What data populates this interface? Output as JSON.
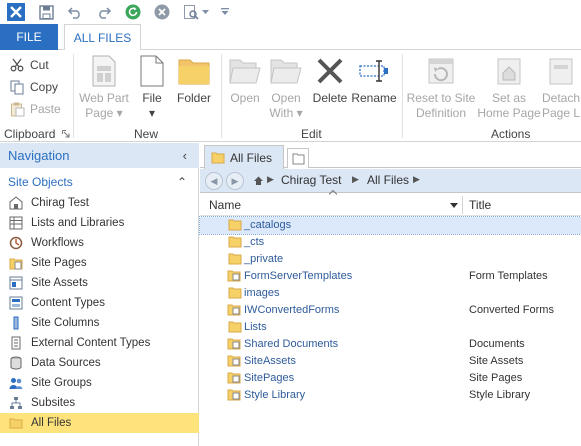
{
  "ribbon_tabs": {
    "file": "FILE",
    "all_files": "ALL FILES"
  },
  "clipboard": {
    "cut": "Cut",
    "copy": "Copy",
    "paste": "Paste",
    "group": "Clipboard"
  },
  "new_group": {
    "web_part_page_1": "Web Part",
    "web_part_page_2": "Page",
    "file": "File",
    "folder": "Folder",
    "group": "New"
  },
  "edit_group": {
    "open": "Open",
    "open_with_1": "Open",
    "open_with_2": "With",
    "delete": "Delete",
    "rename": "Rename",
    "group": "Edit"
  },
  "actions_group": {
    "reset_1": "Reset to Site",
    "reset_2": "Definition",
    "home_1": "Set as",
    "home_2": "Home Page",
    "detach_1": "Detach",
    "detach_2": "Page L",
    "group": "Actions"
  },
  "navigation": {
    "title": "Navigation",
    "section": "Site Objects",
    "items": [
      {
        "label": "Chirag Test",
        "icon": "site-icon"
      },
      {
        "label": "Lists and Libraries",
        "icon": "list-icon"
      },
      {
        "label": "Workflows",
        "icon": "workflow-icon"
      },
      {
        "label": "Site Pages",
        "icon": "pages-icon"
      },
      {
        "label": "Site Assets",
        "icon": "assets-icon"
      },
      {
        "label": "Content Types",
        "icon": "content-types-icon"
      },
      {
        "label": "Site Columns",
        "icon": "columns-icon"
      },
      {
        "label": "External Content Types",
        "icon": "external-content-icon"
      },
      {
        "label": "Data Sources",
        "icon": "data-sources-icon"
      },
      {
        "label": "Site Groups",
        "icon": "groups-icon"
      },
      {
        "label": "Subsites",
        "icon": "subsites-icon"
      },
      {
        "label": "All Files",
        "icon": "folder-icon"
      }
    ]
  },
  "doc_tab": "All Files",
  "breadcrumb": {
    "site": "Chirag Test",
    "current": "All Files"
  },
  "columns": {
    "name": "Name",
    "title": "Title"
  },
  "files": [
    {
      "name": "_catalogs",
      "title": "",
      "kind": "folder"
    },
    {
      "name": "_cts",
      "title": "",
      "kind": "folder"
    },
    {
      "name": "_private",
      "title": "",
      "kind": "folder"
    },
    {
      "name": "FormServerTemplates",
      "title": "Form Templates",
      "kind": "library"
    },
    {
      "name": "images",
      "title": "",
      "kind": "folder"
    },
    {
      "name": "IWConvertedForms",
      "title": "Converted Forms",
      "kind": "library"
    },
    {
      "name": "Lists",
      "title": "",
      "kind": "folder"
    },
    {
      "name": "Shared Documents",
      "title": "Documents",
      "kind": "library"
    },
    {
      "name": "SiteAssets",
      "title": "Site Assets",
      "kind": "library"
    },
    {
      "name": "SitePages",
      "title": "Site Pages",
      "kind": "library"
    },
    {
      "name": "Style Library",
      "title": "Style Library",
      "kind": "library"
    }
  ],
  "colors": {
    "accent": "#2b6fc2",
    "nav_header": "#dbe7f5",
    "selected_nav": "#fee37c",
    "folder": "#f6d167"
  }
}
